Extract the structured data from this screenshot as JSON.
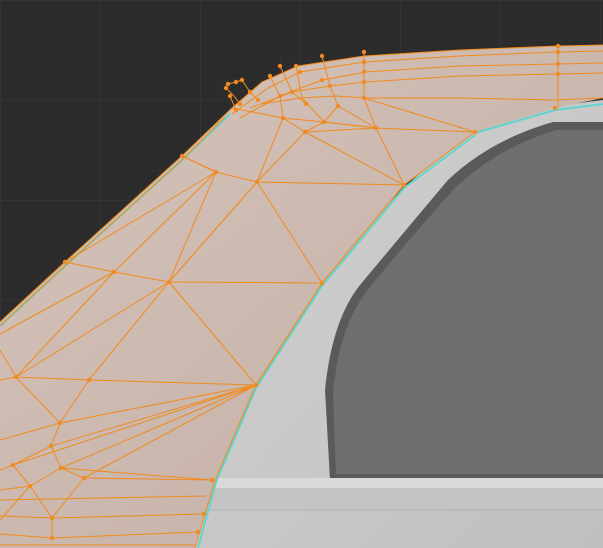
{
  "viewport": {
    "mode": "edit-mode",
    "colors": {
      "background": "#2b2b2b",
      "grid_minor": "#313131",
      "grid_major": "#363636",
      "mesh_face": "#c9b6ac",
      "edge_selected": "#f28a1c",
      "vertex_selected": "#f08a24",
      "seam_cyan": "#5fd4cf",
      "body_light": "#c8c8c8",
      "frame_dark": "#585858",
      "glass": "#6e6e6e"
    }
  }
}
